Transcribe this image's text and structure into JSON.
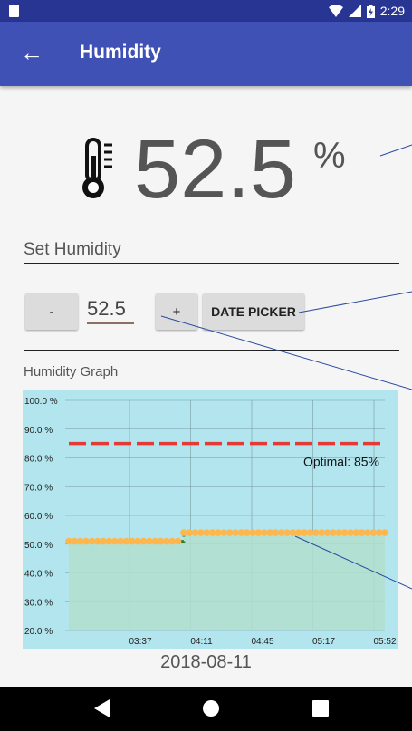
{
  "status": {
    "time": "2:29"
  },
  "app_bar": {
    "title": "Humidity"
  },
  "reading": {
    "value": "52.5",
    "unit": "%"
  },
  "set_humidity": {
    "label": "Set Humidity",
    "minus_label": "-",
    "value": "52.5",
    "plus_label": "+",
    "date_picker_label": "DATE PICKER"
  },
  "graph": {
    "label": "Humidity Graph",
    "date": "2018-08-11"
  },
  "colors": {
    "app_bar": "#3f51b5",
    "status_bar": "#283593",
    "chart_bg": "#b3e5ee",
    "optimal_line": "#e53935",
    "data_line": "#2e7d32",
    "data_point": "#ffb74d",
    "fill": "#b2dfcc"
  },
  "chart_data": {
    "type": "line",
    "y_ticks": [
      "100.0 %",
      "90.0 %",
      "80.0 %",
      "70.0 %",
      "60.0 %",
      "50.0 %",
      "40.0 %",
      "30.0 %",
      "20.0 %"
    ],
    "x_ticks": [
      "03:37",
      "04:11",
      "04:45",
      "05:17",
      "05:52"
    ],
    "ylim": [
      20,
      100
    ],
    "optimal": {
      "value": 85,
      "label": "Optimal: 85%"
    },
    "series": [
      {
        "values": [
          51,
          51,
          51,
          51,
          51,
          51,
          51,
          51,
          51,
          51,
          51,
          51,
          51,
          51,
          51,
          51,
          51,
          51,
          51,
          51,
          54,
          54,
          54,
          54,
          54,
          54,
          54,
          54,
          54,
          54,
          54,
          54,
          54,
          54,
          54,
          54,
          54,
          54,
          54,
          54,
          54,
          54,
          54,
          54,
          54,
          54,
          54,
          54,
          54,
          54,
          54,
          54,
          54,
          54,
          54,
          54
        ]
      }
    ]
  }
}
